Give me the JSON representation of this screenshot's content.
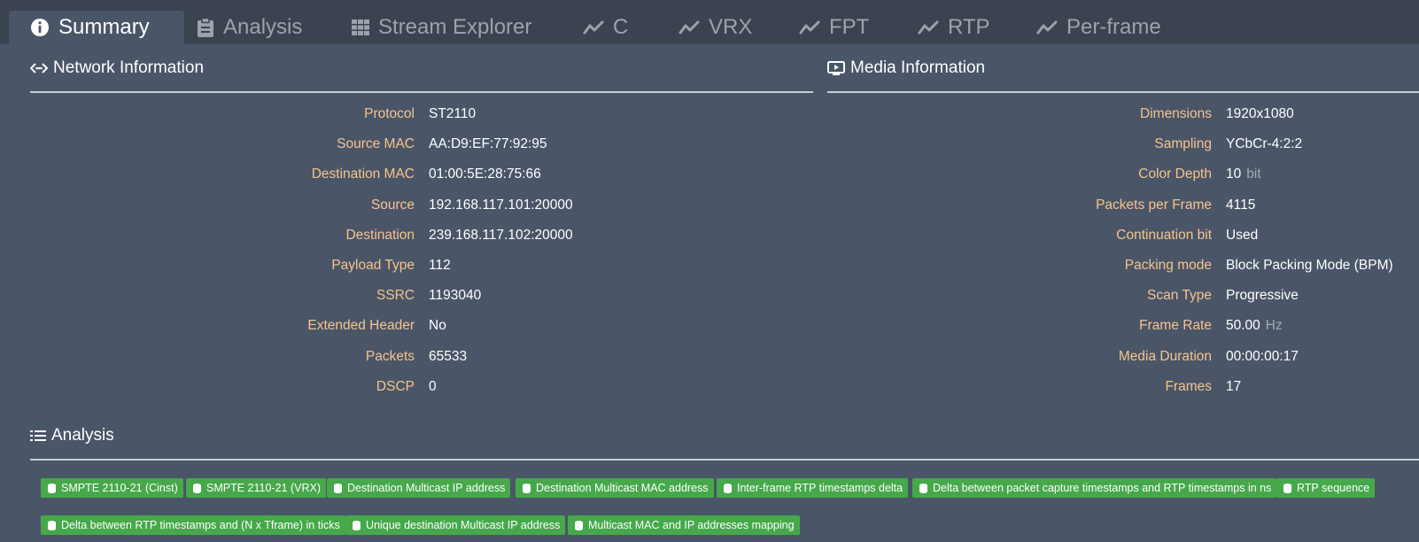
{
  "tabs": [
    {
      "label": "Summary",
      "icon": "info-icon",
      "active": true
    },
    {
      "label": "Analysis",
      "icon": "clipboard-icon"
    },
    {
      "label": "Stream Explorer",
      "icon": "grid-icon"
    },
    {
      "label": "C",
      "icon": "line-chart-icon"
    },
    {
      "label": "VRX",
      "icon": "line-chart-icon"
    },
    {
      "label": "FPT",
      "icon": "line-chart-icon"
    },
    {
      "label": "RTP",
      "icon": "line-chart-icon"
    },
    {
      "label": "Per-frame",
      "icon": "line-chart-icon"
    }
  ],
  "network": {
    "title": "Network Information",
    "rows": [
      {
        "label": "Protocol",
        "value": "ST2110"
      },
      {
        "label": "Source MAC",
        "value": "AA:D9:EF:77:92:95"
      },
      {
        "label": "Destination MAC",
        "value": "01:00:5E:28:75:66"
      },
      {
        "label": "Source",
        "value": "192.168.117.101:20000"
      },
      {
        "label": "Destination",
        "value": "239.168.117.102:20000"
      },
      {
        "label": "Payload Type",
        "value": "112"
      },
      {
        "label": "SSRC",
        "value": "1193040"
      },
      {
        "label": "Extended Header",
        "value": "No"
      },
      {
        "label": "Packets",
        "value": "65533"
      },
      {
        "label": "DSCP",
        "value": "0"
      }
    ]
  },
  "media": {
    "title": "Media Information",
    "rows": [
      {
        "label": "Dimensions",
        "value": "1920x1080",
        "unit": ""
      },
      {
        "label": "Sampling",
        "value": "YCbCr-4:2:2",
        "unit": ""
      },
      {
        "label": "Color Depth",
        "value": "10",
        "unit": "bit"
      },
      {
        "label": "Packets per Frame",
        "value": "4115",
        "unit": ""
      },
      {
        "label": "Continuation bit",
        "value": "Used",
        "unit": ""
      },
      {
        "label": "Packing mode",
        "value": "Block Packing Mode (BPM)",
        "unit": ""
      },
      {
        "label": "Scan Type",
        "value": "Progressive",
        "unit": ""
      },
      {
        "label": "Frame Rate",
        "value": "50.00",
        "unit": "Hz"
      },
      {
        "label": "Media Duration",
        "value": "00:00:00:17",
        "unit": ""
      },
      {
        "label": "Frames",
        "value": "17",
        "unit": ""
      }
    ]
  },
  "analysis": {
    "title": "Analysis",
    "badges": [
      "SMPTE 2110-21 (Cinst)",
      "SMPTE 2110-21 (VRX)",
      "Destination Multicast IP address",
      "Destination Multicast MAC address",
      "Inter-frame RTP timestamps delta",
      "Delta between packet capture timestamps and RTP timestamps in ns",
      "RTP sequence",
      "Delta between RTP timestamps and (N x Tframe) in ticks",
      "Unique destination Multicast IP address",
      "Multicast MAC and IP addresses mapping"
    ],
    "badge_color": "#46a84a"
  },
  "colors": {
    "label": "#f6c48c",
    "background": "#4a5568",
    "tabbar": "#3b4350"
  }
}
